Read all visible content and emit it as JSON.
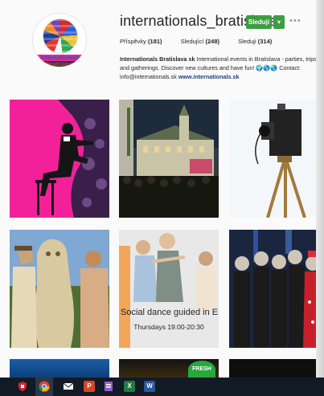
{
  "profile": {
    "username": "internationals_bratislava",
    "avatar_text_1": "Internationals",
    "avatar_text_2": "Bratislava",
    "follow_label": "Sledují",
    "follow_dropdown_icon": "caret-down-icon",
    "more_icon": "ellipsis-icon"
  },
  "stats": {
    "posts_label": "Příspěvky",
    "posts_count": "(181)",
    "followers_label": "Sledující",
    "followers_count": "(248)",
    "following_label": "Sleduji",
    "following_count": "(314)"
  },
  "bio": {
    "name": "Internationals Bratislava sk",
    "text": " International events in Bratislava - parties, trips and gatherings. Discover new cultures and have fun! 🌍🌎🌏 Contact: info@internationals.sk ",
    "website": "www.internationals.sk"
  },
  "posts": [
    {
      "id": "post-1",
      "depicts": "silhouette-man-on-chair"
    },
    {
      "id": "post-2",
      "depicts": "night-town-square"
    },
    {
      "id": "post-3",
      "depicts": "vintage-camera-tripod"
    },
    {
      "id": "post-4",
      "depicts": "people-with-statue"
    },
    {
      "id": "post-5",
      "depicts": "dance-couple",
      "caption_1": "Social dance guided in Eng",
      "caption_2": "Thursdays 19:00-20:30"
    },
    {
      "id": "post-6",
      "depicts": "halloween-party"
    },
    {
      "id": "post-7",
      "depicts": "blue-photo"
    },
    {
      "id": "post-8",
      "depicts": "fresh-sign",
      "badge": "FRESH"
    },
    {
      "id": "post-9",
      "depicts": "dark-photo"
    }
  ],
  "taskbar": {
    "icons": [
      "shield-icon",
      "chrome-icon",
      "mail-icon",
      "powerpoint-icon",
      "document-icon",
      "excel-icon",
      "word-icon"
    ],
    "excel_letter": "X",
    "word_letter": "W",
    "powerpoint_letter": "P"
  },
  "colors": {
    "accent_green": "#3d9d42",
    "link_blue": "#1e3f7a",
    "taskbar": "#121b25"
  }
}
